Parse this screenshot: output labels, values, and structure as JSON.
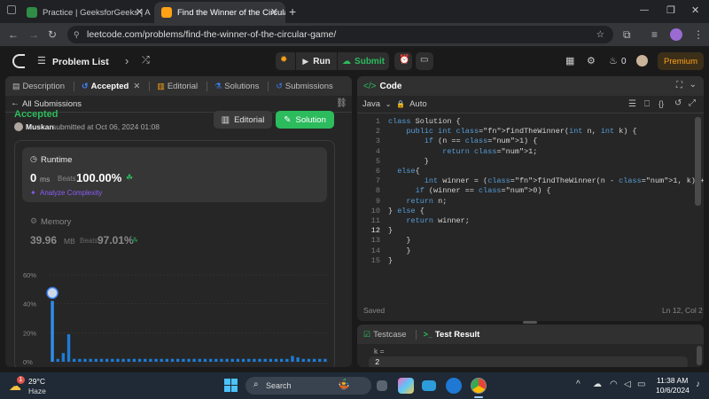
{
  "browser": {
    "tabs": [
      {
        "title": "Practice | GeeksforGeeks | A co",
        "active": false
      },
      {
        "title": "Find the Winner of the Circular",
        "active": true
      }
    ],
    "new_tab": "+",
    "window_controls": {
      "min": "—",
      "max": "❐",
      "close": "✕"
    },
    "url": "leetcode.com/problems/find-the-winner-of-the-circular-game/"
  },
  "leetcode_top": {
    "problem_list": "Problem List",
    "run": "Run",
    "submit": "Submit",
    "streak": "0",
    "premium": "Premium"
  },
  "left_panel": {
    "tabs": {
      "description": "Description",
      "accepted": "Accepted",
      "editorial": "Editorial",
      "solutions": "Solutions",
      "submissions": "Submissions"
    },
    "all_submissions": "All Submissions",
    "status": "Accepted",
    "user": "Muskan",
    "submitted_text": "submitted at Oct 06, 2024 01:08",
    "editorial_btn": "Editorial",
    "solution_btn": "Solution",
    "runtime": {
      "title": "Runtime",
      "value": "0",
      "unit": "ms",
      "beats_label": "Beats",
      "beats": "100.00%",
      "analyze": "Analyze Complexity"
    },
    "memory": {
      "title": "Memory",
      "value": "39.96",
      "unit": "MB",
      "beats_label": "Beats",
      "beats": "97.01%"
    },
    "chart_data": {
      "type": "bar",
      "y_ticks": [
        "60%",
        "40%",
        "20%",
        "0%"
      ],
      "ylim": [
        0,
        60
      ],
      "values": [
        42,
        2,
        6,
        19,
        2,
        2,
        2,
        2,
        2,
        2,
        2,
        2,
        2,
        2,
        2,
        2,
        2,
        2,
        2,
        2,
        2,
        2,
        2,
        2,
        2,
        2,
        2,
        2,
        2,
        2,
        2,
        2,
        2,
        2,
        2,
        2,
        2,
        2,
        2,
        2,
        2,
        2,
        2,
        2,
        4,
        3,
        2,
        2,
        2,
        2,
        2
      ],
      "highlight_index": 0,
      "colors": {
        "bar": "#1e7bd6",
        "highlight": "#2f8ef0"
      }
    }
  },
  "code_panel": {
    "title": "Code",
    "language": "Java",
    "mode": "Auto",
    "lines": [
      "class Solution {",
      "    public int findTheWinner(int n, int k) {",
      "        if (n == 1) {",
      "            return 1;",
      "        }",
      "  else{",
      "        int winner = (findTheWinner(n - 1, k) + k) % n;",
      "      if (winner == 0) {",
      "    return n;",
      "} else {",
      "    return winner;",
      "}",
      "    }",
      "    }",
      "}"
    ],
    "current_line": 12,
    "saved": "Saved",
    "cursor": "Ln 12, Col 2"
  },
  "test_panel": {
    "testcase_tab": "Testcase",
    "result_tab": "Test Result",
    "var_label": "k =",
    "var_value": "2"
  },
  "taskbar": {
    "weather_temp": "29°C",
    "weather_desc": "Haze",
    "search": "Search",
    "time": "11:38 AM",
    "date": "10/6/2024",
    "notif_count": "1"
  }
}
